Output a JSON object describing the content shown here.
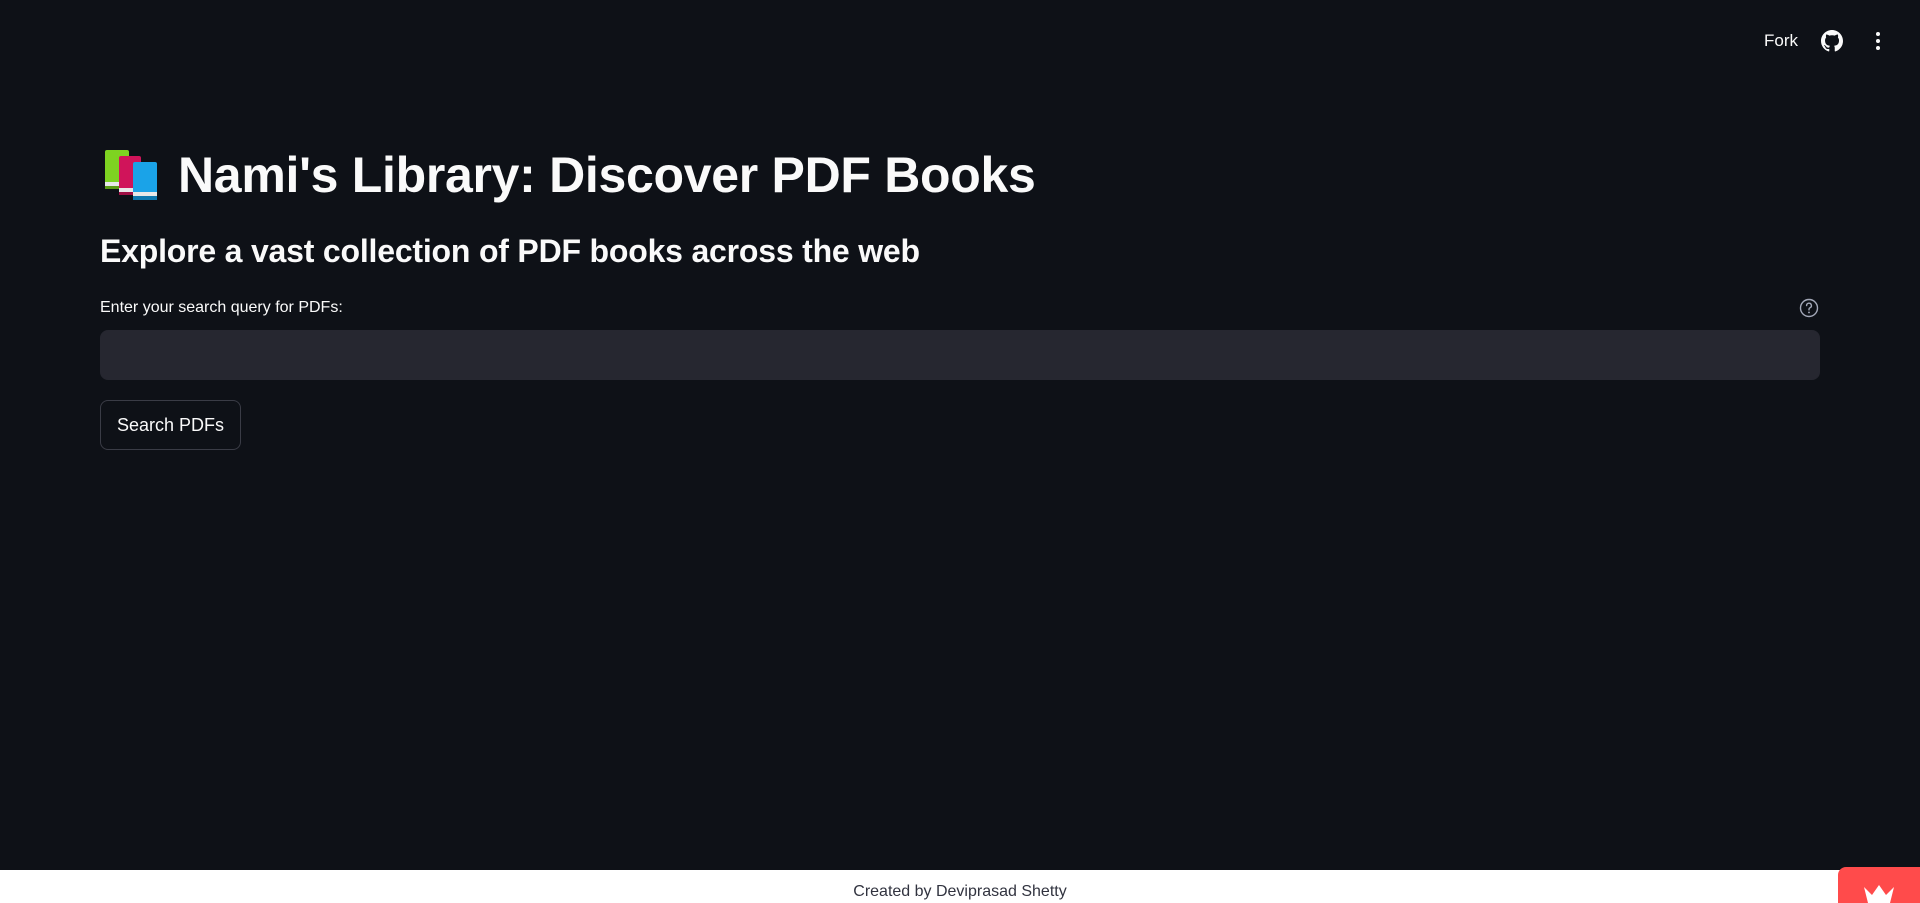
{
  "header": {
    "fork_label": "Fork",
    "icons": [
      "github-icon",
      "more-vertical-icon"
    ]
  },
  "main": {
    "title_emoji": "books-icon",
    "title": "Nami's Library: Discover PDF Books",
    "subtitle": "Explore a vast collection of PDF books across the web",
    "search": {
      "label": "Enter your search query for PDFs:",
      "value": "",
      "placeholder": "",
      "help_icon": "help-circle-icon"
    },
    "search_button_label": "Search PDFs"
  },
  "footer": {
    "text": "Created by Deviprasad Shetty",
    "badge_icon": "streamlit-crown-icon"
  },
  "colors": {
    "background": "#0e1117",
    "input_background": "#262730",
    "text": "#fafafa",
    "footer_background": "#ffffff",
    "footer_text": "#31333f",
    "badge": "#ff4b4b"
  }
}
